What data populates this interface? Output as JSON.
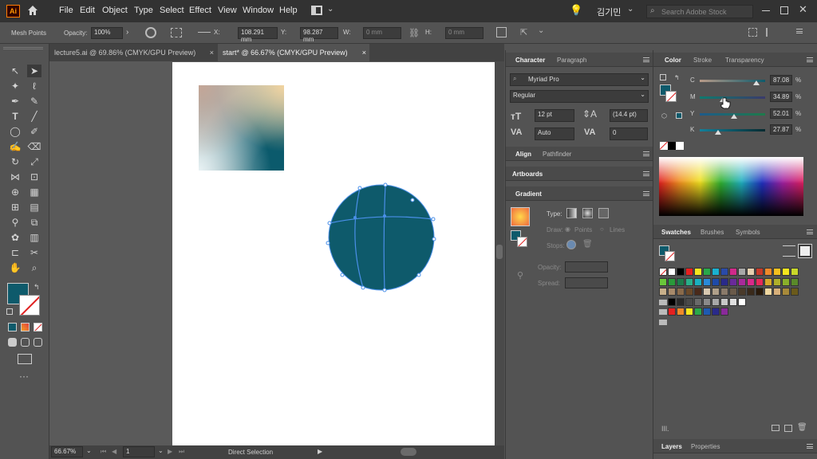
{
  "app_icon": "Ai",
  "menu": [
    "File",
    "Edit",
    "Object",
    "Type",
    "Select",
    "Effect",
    "View",
    "Window",
    "Help"
  ],
  "user_name": "김기민",
  "search_placeholder": "Search Adobe Stock",
  "control": {
    "mode_label": "Mesh Points",
    "opacity_label": "Opacity:",
    "opacity_value": "100%",
    "x_label": "X:",
    "x_value": "108.291 mm",
    "y_label": "Y:",
    "y_value": "98.287 mm",
    "w_label": "W:",
    "w_value": "0 mm",
    "h_label": "H:",
    "h_value": "0 mm"
  },
  "tabs": [
    {
      "label": "lecture5.ai @ 69.86% (CMYK/GPU Preview)",
      "close": "×"
    },
    {
      "label": "start* @ 66.67% (CMYK/GPU Preview)",
      "close": "×"
    }
  ],
  "status": {
    "zoom": "66.67%",
    "page": "1",
    "tool": "Direct Selection"
  },
  "character": {
    "tab_character": "Character",
    "tab_paragraph": "Paragraph",
    "font": "Myriad Pro",
    "style": "Regular",
    "size": "12 pt",
    "leading": "(14.4 pt)",
    "kerning": "Auto",
    "tracking": "0"
  },
  "align": {
    "tab_align": "Align",
    "tab_pathfinder": "Pathfinder"
  },
  "artboards": {
    "tab": "Artboards"
  },
  "gradient": {
    "tab": "Gradient",
    "type_label": "Type:",
    "draw_label": "Draw:",
    "points_label": "Points",
    "lines_label": "Lines",
    "stops_label": "Stops:",
    "opacity_label": "Opacity:",
    "spread_label": "Spread:"
  },
  "color": {
    "tab_color": "Color",
    "tab_stroke": "Stroke",
    "tab_transparency": "Transparency",
    "channels": [
      {
        "name": "C",
        "value": "87.08",
        "unit": "%",
        "fraction": 0.87
      },
      {
        "name": "M",
        "value": "34.89",
        "unit": "%",
        "fraction": 0.35
      },
      {
        "name": "Y",
        "value": "52.01",
        "unit": "%",
        "fraction": 0.52
      },
      {
        "name": "K",
        "value": "27.87",
        "unit": "%",
        "fraction": 0.28
      }
    ],
    "fill_color": "#0e5a6b"
  },
  "swatches": {
    "tab_swatches": "Swatches",
    "tab_brushes": "Brushes",
    "tab_symbols": "Symbols"
  },
  "layers": {
    "tab_layers": "Layers",
    "tab_properties": "Properties"
  }
}
